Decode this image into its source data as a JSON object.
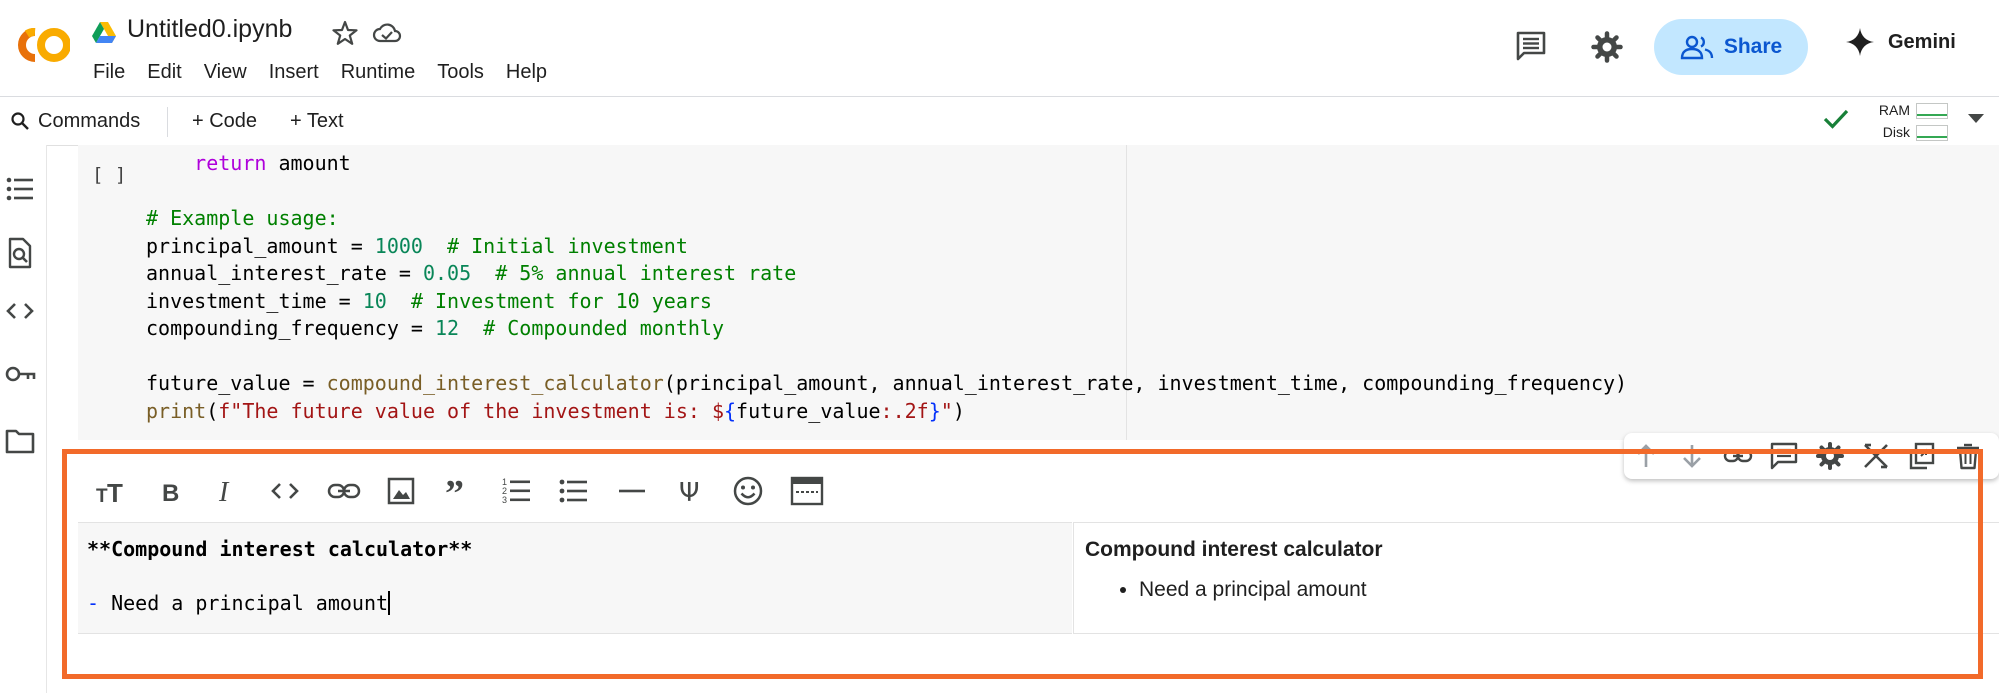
{
  "header": {
    "logo_text": "CO",
    "title": "Untitled0.ipynb",
    "menu": [
      "File",
      "Edit",
      "View",
      "Insert",
      "Runtime",
      "Tools",
      "Help"
    ],
    "share_label": "Share",
    "gemini_label": "Gemini"
  },
  "toolbar": {
    "commands_label": "Commands",
    "add_code_label": "+ Code",
    "add_text_label": "+ Text",
    "ram_label": "RAM",
    "disk_label": "Disk"
  },
  "code_cell": {
    "run_indicator": "[ ]"
  },
  "text_cell": {
    "editor_lines": [
      "**Compound interest calculator**",
      "- Need a principal amount"
    ],
    "preview_heading": "Compound interest calculator",
    "preview_items": [
      "Need a principal amount"
    ]
  },
  "icons": {
    "rail": [
      "table-of-contents-icon",
      "find-replace-icon",
      "code-snippets-icon",
      "secrets-key-icon",
      "files-folder-icon"
    ],
    "md_toolbar": [
      "heading-icon",
      "bold-icon",
      "italic-icon",
      "code-icon",
      "link-icon",
      "image-icon",
      "quote-icon",
      "numbered-list-icon",
      "bulleted-list-icon",
      "horizontal-rule-icon",
      "latex-psi-icon",
      "emoji-icon",
      "table-icon"
    ],
    "cell_actions": [
      "move-up-icon",
      "move-down-icon",
      "link-cell-icon",
      "comment-icon",
      "cell-settings-icon",
      "mirror-cell-icon",
      "copy-cell-icon",
      "delete-icon"
    ]
  },
  "colors": {
    "accent": "#0b57d0",
    "share_bg": "#c2e7ff",
    "highlight": "#f26a2a",
    "status_ok": "#34a853",
    "keyword": "#af00db",
    "comment": "#008000",
    "number": "#098658",
    "string": "#a31515"
  }
}
